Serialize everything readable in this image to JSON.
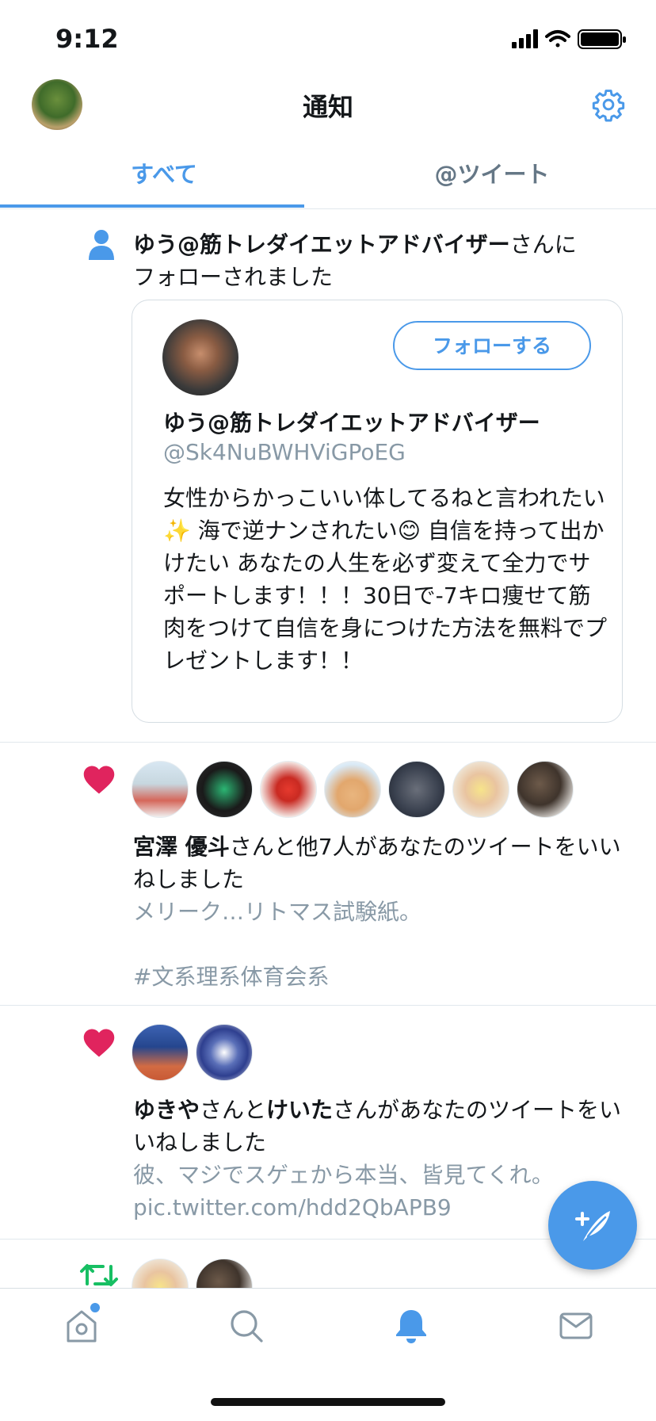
{
  "status_bar": {
    "time": "9:12"
  },
  "header": {
    "title": "通知"
  },
  "tabs": {
    "all": "すべて",
    "mentions": "@ツイート"
  },
  "follow_notification": {
    "user_name": "ゆう@筋トレダイエットアドバイザー",
    "suffix_line1": "さんに",
    "suffix_line2": "フォローされました",
    "card": {
      "follow_button": "フォローする",
      "name": "ゆう@筋トレダイエットアドバイザー",
      "handle": "@Sk4NuBWHViGPoEG",
      "bio": "女性からかっこいい体してるねと言われたい✨ 海で逆ナンされたい😊 自信を持って出かけたい あなたの人生を必ず変えて全力でサポートします！！！30日で-7キロ痩せて筋肉をつけて自信を身につけた方法を無料でプレゼントします！！"
    }
  },
  "like_notification_1": {
    "user_name": "宮澤 優斗",
    "text": "さんと他7人があなたのツイートをいいねしました",
    "tweet_line1": "メリーク…リトマス試験紙。",
    "tweet_line2": "#文系理系体育会系"
  },
  "like_notification_2": {
    "user1": "ゆきや",
    "middle": "さんと",
    "user2": "けいた",
    "text": "さんがあなたのツイートをいいねしました",
    "tweet_line1": "彼、マジでスゲェから本当、皆見てくれ。",
    "tweet_line2": "pic.twitter.com/hdd2QbAPB9"
  },
  "icons": {
    "follow": "person-icon",
    "like": "heart-icon",
    "retweet": "retweet-icon",
    "settings": "gear-icon",
    "compose": "compose-tweet-icon",
    "nav": [
      "home-icon",
      "search-icon",
      "bell-icon",
      "mail-icon"
    ]
  },
  "colors": {
    "accent": "#4a99e9",
    "like": "#e0245e",
    "retweet": "#17bf63",
    "muted": "#8899a6"
  }
}
